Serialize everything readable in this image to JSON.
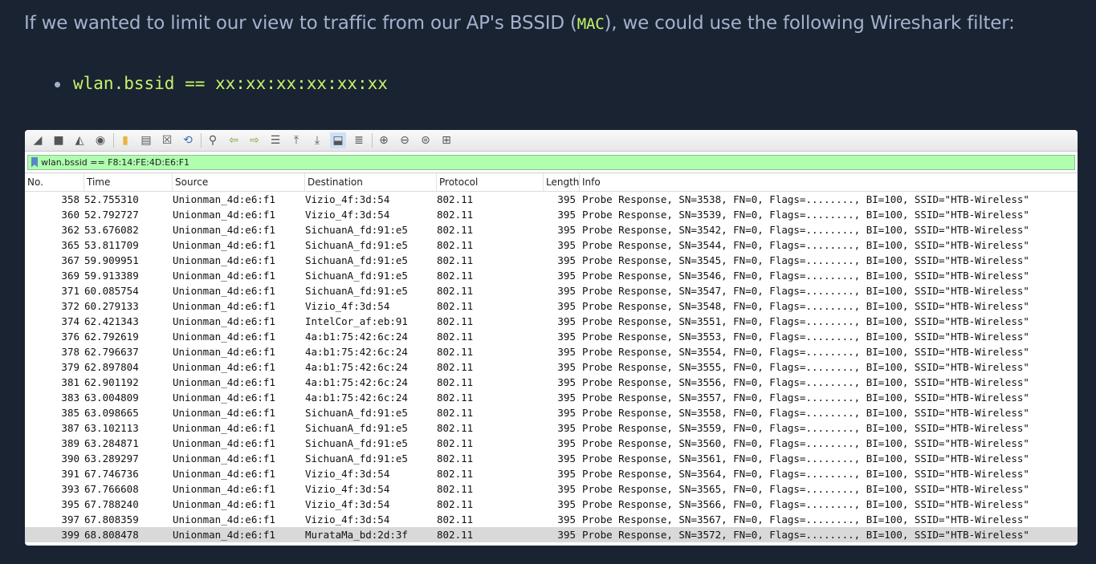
{
  "intro": {
    "before": "If we wanted to limit our view to traffic from our AP's BSSID (",
    "code": "MAC",
    "after": "), we could use the following Wireshark filter:"
  },
  "bullet": {
    "code": "wlan.bssid == xx:xx:xx:xx:xx:xx"
  },
  "wireshark": {
    "toolbar_icons": [
      "fin-icon",
      "stop-icon",
      "restart-icon",
      "options-icon",
      "open-icon",
      "file-icon",
      "close-file-icon",
      "reload-icon",
      "find-icon",
      "back-icon",
      "forward-icon",
      "goto-icon",
      "first-icon",
      "last-icon",
      "autoscroll-icon",
      "colorize-icon",
      "zoom-in-icon",
      "zoom-out-icon",
      "zoom-normal-icon",
      "resize-columns-icon"
    ],
    "filter": "wlan.bssid == F8:14:FE:4D:E6:F1",
    "columns": {
      "no": "No.",
      "time": "Time",
      "source": "Source",
      "destination": "Destination",
      "protocol": "Protocol",
      "length": "Length",
      "info": "Info"
    },
    "rows": [
      {
        "no": "358",
        "time": "52.755310",
        "src": "Unionman_4d:e6:f1",
        "dst": "Vizio_4f:3d:54",
        "proto": "802.11",
        "len": "395",
        "info": "Probe Response, SN=3538, FN=0, Flags=........, BI=100, SSID=\"HTB-Wireless\""
      },
      {
        "no": "360",
        "time": "52.792727",
        "src": "Unionman_4d:e6:f1",
        "dst": "Vizio_4f:3d:54",
        "proto": "802.11",
        "len": "395",
        "info": "Probe Response, SN=3539, FN=0, Flags=........, BI=100, SSID=\"HTB-Wireless\""
      },
      {
        "no": "362",
        "time": "53.676082",
        "src": "Unionman_4d:e6:f1",
        "dst": "SichuanA_fd:91:e5",
        "proto": "802.11",
        "len": "395",
        "info": "Probe Response, SN=3542, FN=0, Flags=........, BI=100, SSID=\"HTB-Wireless\""
      },
      {
        "no": "365",
        "time": "53.811709",
        "src": "Unionman_4d:e6:f1",
        "dst": "SichuanA_fd:91:e5",
        "proto": "802.11",
        "len": "395",
        "info": "Probe Response, SN=3544, FN=0, Flags=........, BI=100, SSID=\"HTB-Wireless\""
      },
      {
        "no": "367",
        "time": "59.909951",
        "src": "Unionman_4d:e6:f1",
        "dst": "SichuanA_fd:91:e5",
        "proto": "802.11",
        "len": "395",
        "info": "Probe Response, SN=3545, FN=0, Flags=........, BI=100, SSID=\"HTB-Wireless\""
      },
      {
        "no": "369",
        "time": "59.913389",
        "src": "Unionman_4d:e6:f1",
        "dst": "SichuanA_fd:91:e5",
        "proto": "802.11",
        "len": "395",
        "info": "Probe Response, SN=3546, FN=0, Flags=........, BI=100, SSID=\"HTB-Wireless\""
      },
      {
        "no": "371",
        "time": "60.085754",
        "src": "Unionman_4d:e6:f1",
        "dst": "SichuanA_fd:91:e5",
        "proto": "802.11",
        "len": "395",
        "info": "Probe Response, SN=3547, FN=0, Flags=........, BI=100, SSID=\"HTB-Wireless\""
      },
      {
        "no": "372",
        "time": "60.279133",
        "src": "Unionman_4d:e6:f1",
        "dst": "Vizio_4f:3d:54",
        "proto": "802.11",
        "len": "395",
        "info": "Probe Response, SN=3548, FN=0, Flags=........, BI=100, SSID=\"HTB-Wireless\""
      },
      {
        "no": "374",
        "time": "62.421343",
        "src": "Unionman_4d:e6:f1",
        "dst": "IntelCor_af:eb:91",
        "proto": "802.11",
        "len": "395",
        "info": "Probe Response, SN=3551, FN=0, Flags=........, BI=100, SSID=\"HTB-Wireless\""
      },
      {
        "no": "376",
        "time": "62.792619",
        "src": "Unionman_4d:e6:f1",
        "dst": "4a:b1:75:42:6c:24",
        "proto": "802.11",
        "len": "395",
        "info": "Probe Response, SN=3553, FN=0, Flags=........, BI=100, SSID=\"HTB-Wireless\""
      },
      {
        "no": "378",
        "time": "62.796637",
        "src": "Unionman_4d:e6:f1",
        "dst": "4a:b1:75:42:6c:24",
        "proto": "802.11",
        "len": "395",
        "info": "Probe Response, SN=3554, FN=0, Flags=........, BI=100, SSID=\"HTB-Wireless\""
      },
      {
        "no": "379",
        "time": "62.897804",
        "src": "Unionman_4d:e6:f1",
        "dst": "4a:b1:75:42:6c:24",
        "proto": "802.11",
        "len": "395",
        "info": "Probe Response, SN=3555, FN=0, Flags=........, BI=100, SSID=\"HTB-Wireless\""
      },
      {
        "no": "381",
        "time": "62.901192",
        "src": "Unionman_4d:e6:f1",
        "dst": "4a:b1:75:42:6c:24",
        "proto": "802.11",
        "len": "395",
        "info": "Probe Response, SN=3556, FN=0, Flags=........, BI=100, SSID=\"HTB-Wireless\""
      },
      {
        "no": "383",
        "time": "63.004809",
        "src": "Unionman_4d:e6:f1",
        "dst": "4a:b1:75:42:6c:24",
        "proto": "802.11",
        "len": "395",
        "info": "Probe Response, SN=3557, FN=0, Flags=........, BI=100, SSID=\"HTB-Wireless\""
      },
      {
        "no": "385",
        "time": "63.098665",
        "src": "Unionman_4d:e6:f1",
        "dst": "SichuanA_fd:91:e5",
        "proto": "802.11",
        "len": "395",
        "info": "Probe Response, SN=3558, FN=0, Flags=........, BI=100, SSID=\"HTB-Wireless\""
      },
      {
        "no": "387",
        "time": "63.102113",
        "src": "Unionman_4d:e6:f1",
        "dst": "SichuanA_fd:91:e5",
        "proto": "802.11",
        "len": "395",
        "info": "Probe Response, SN=3559, FN=0, Flags=........, BI=100, SSID=\"HTB-Wireless\""
      },
      {
        "no": "389",
        "time": "63.284871",
        "src": "Unionman_4d:e6:f1",
        "dst": "SichuanA_fd:91:e5",
        "proto": "802.11",
        "len": "395",
        "info": "Probe Response, SN=3560, FN=0, Flags=........, BI=100, SSID=\"HTB-Wireless\""
      },
      {
        "no": "390",
        "time": "63.289297",
        "src": "Unionman_4d:e6:f1",
        "dst": "SichuanA_fd:91:e5",
        "proto": "802.11",
        "len": "395",
        "info": "Probe Response, SN=3561, FN=0, Flags=........, BI=100, SSID=\"HTB-Wireless\""
      },
      {
        "no": "391",
        "time": "67.746736",
        "src": "Unionman_4d:e6:f1",
        "dst": "Vizio_4f:3d:54",
        "proto": "802.11",
        "len": "395",
        "info": "Probe Response, SN=3564, FN=0, Flags=........, BI=100, SSID=\"HTB-Wireless\""
      },
      {
        "no": "393",
        "time": "67.766608",
        "src": "Unionman_4d:e6:f1",
        "dst": "Vizio_4f:3d:54",
        "proto": "802.11",
        "len": "395",
        "info": "Probe Response, SN=3565, FN=0, Flags=........, BI=100, SSID=\"HTB-Wireless\""
      },
      {
        "no": "395",
        "time": "67.788240",
        "src": "Unionman_4d:e6:f1",
        "dst": "Vizio_4f:3d:54",
        "proto": "802.11",
        "len": "395",
        "info": "Probe Response, SN=3566, FN=0, Flags=........, BI=100, SSID=\"HTB-Wireless\""
      },
      {
        "no": "397",
        "time": "67.808359",
        "src": "Unionman_4d:e6:f1",
        "dst": "Vizio_4f:3d:54",
        "proto": "802.11",
        "len": "395",
        "info": "Probe Response, SN=3567, FN=0, Flags=........, BI=100, SSID=\"HTB-Wireless\""
      },
      {
        "no": "399",
        "time": "68.808478",
        "src": "Unionman_4d:e6:f1",
        "dst": "MurataMa_bd:2d:3f",
        "proto": "802.11",
        "len": "395",
        "info": "Probe Response, SN=3572, FN=0, Flags=........, BI=100, SSID=\"HTB-Wireless\"",
        "selected": true
      }
    ]
  },
  "colors": {
    "page_bg": "#1a2332",
    "text": "#a4b1cd",
    "code": "#c5f467",
    "filter_ok": "#afffaf",
    "selected_row": "#d9d9d9"
  }
}
